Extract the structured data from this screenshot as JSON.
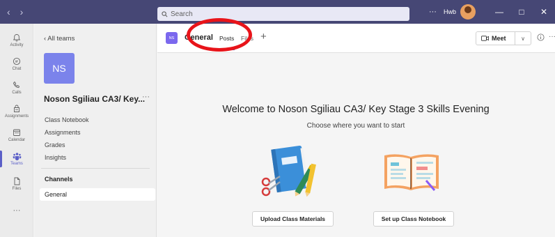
{
  "titlebar": {
    "back_arrow": "‹",
    "forward_arrow": "›",
    "search_placeholder": "Search",
    "more": "···",
    "org_label": "Hwb",
    "minimize": "—",
    "maximize": "□",
    "close": "✕"
  },
  "rail": {
    "items": [
      {
        "label": "Activity",
        "icon": "bell-icon"
      },
      {
        "label": "Chat",
        "icon": "chat-icon"
      },
      {
        "label": "Calls",
        "icon": "phone-icon"
      },
      {
        "label": "Assignments",
        "icon": "assignments-icon"
      },
      {
        "label": "Calendar",
        "icon": "calendar-icon"
      },
      {
        "label": "Teams",
        "icon": "teams-icon"
      },
      {
        "label": "Files",
        "icon": "file-icon"
      }
    ],
    "more": "···"
  },
  "panel": {
    "back_label": "‹   All teams",
    "team_initials": "NS",
    "team_name": "Noson Sgiliau CA3/ Key...",
    "team_more": "···",
    "links": [
      "Class Notebook",
      "Assignments",
      "Grades",
      "Insights"
    ],
    "channels_heading": "Channels",
    "channel_general": "General"
  },
  "header": {
    "channel_initials": "NS",
    "channel_title": "General",
    "tab_posts": "Posts",
    "tab_files": "Files",
    "add_tab": "+",
    "meet_label": "Meet",
    "meet_chevron": "∨",
    "more": "···"
  },
  "main": {
    "welcome": "Welcome to Noson Sgiliau CA3/ Key Stage 3 Skills Evening",
    "choose": "Choose where you want to start",
    "upload_button": "Upload Class Materials",
    "notebook_button": "Set up Class Notebook"
  },
  "colors": {
    "titlebar": "#464775",
    "accent": "#5b5fc7",
    "team_tile": "#7b83eb",
    "annotation": "#e8141a"
  }
}
